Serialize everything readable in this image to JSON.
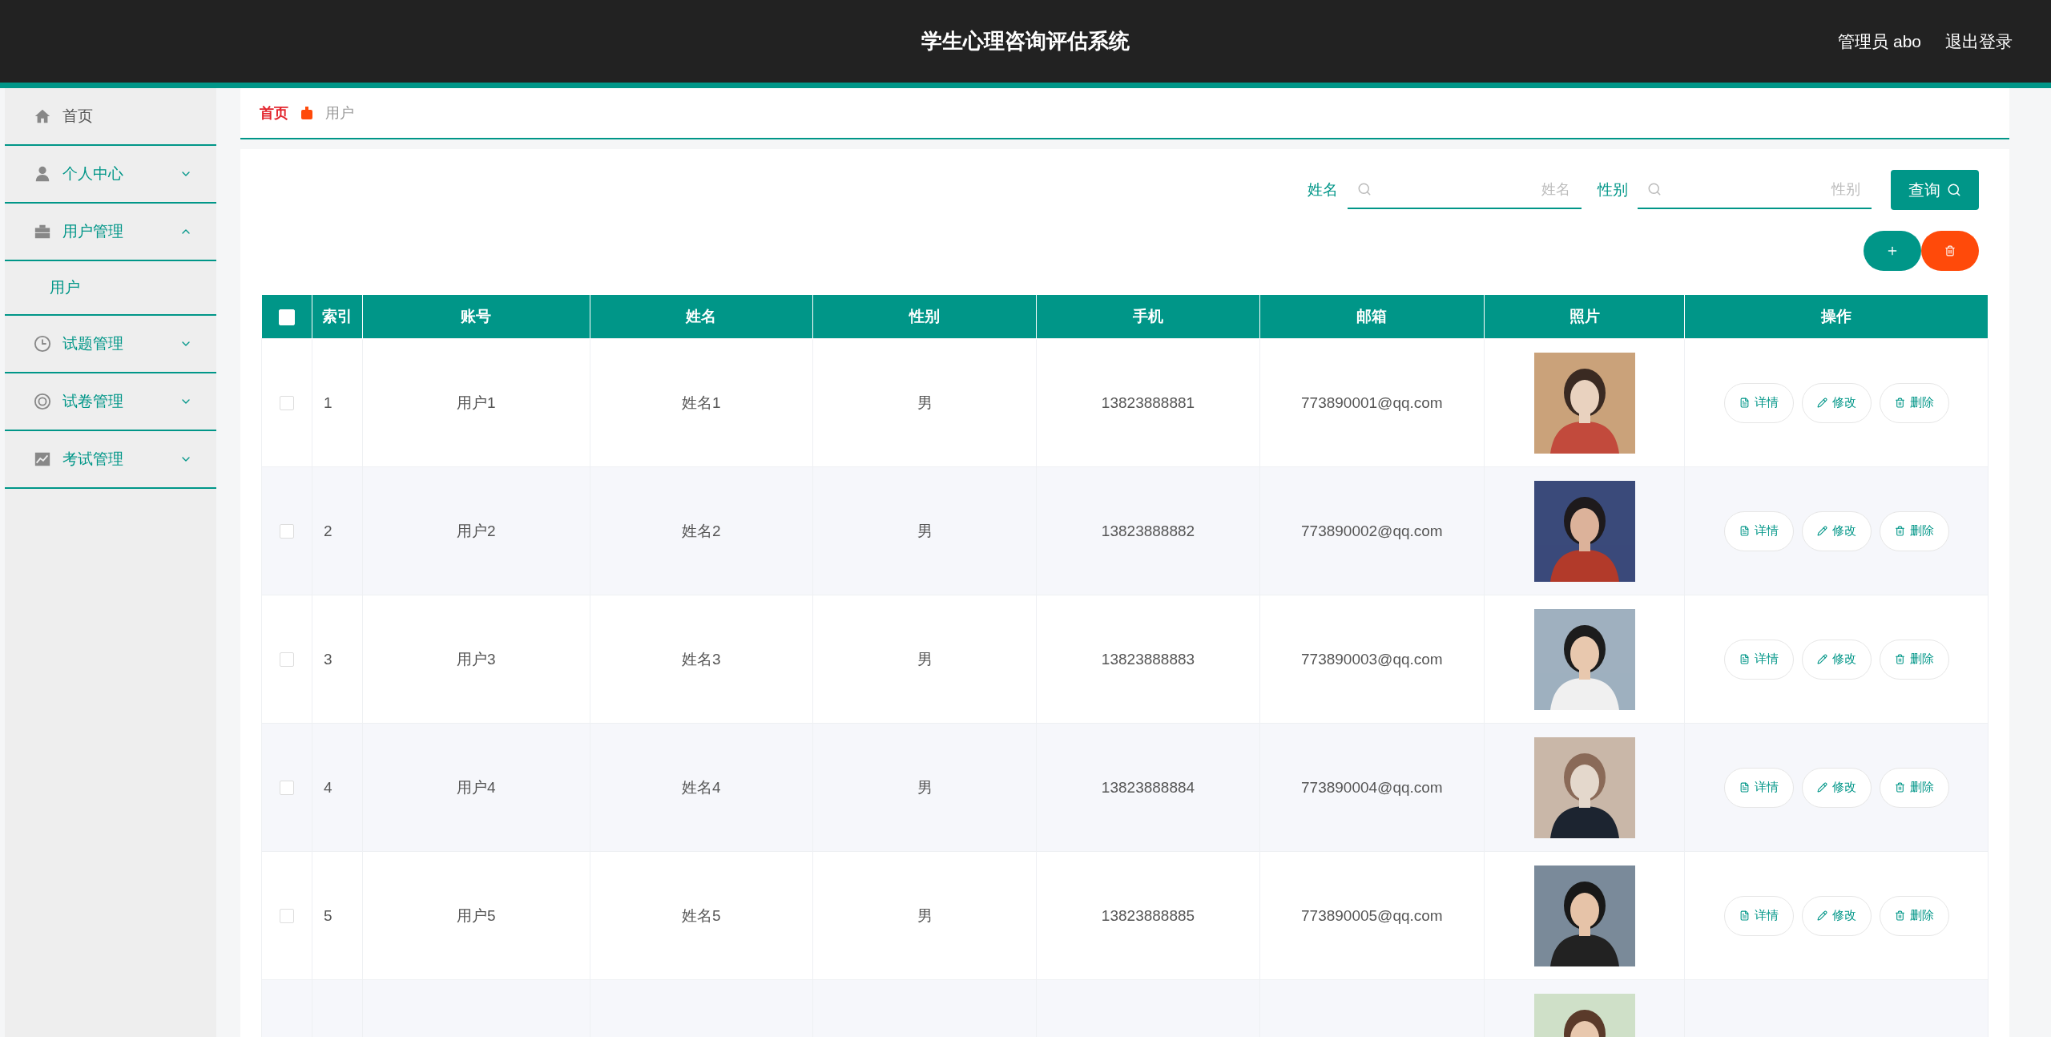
{
  "header": {
    "title": "学生心理咨询评估系统",
    "user": "管理员 abo",
    "logout": "退出登录"
  },
  "sidebar": {
    "items": [
      {
        "label": "首页",
        "kind": "link"
      },
      {
        "label": "个人中心",
        "kind": "menu",
        "expanded": false
      },
      {
        "label": "用户管理",
        "kind": "menu",
        "expanded": true,
        "children": [
          {
            "label": "用户",
            "selected": true
          }
        ]
      },
      {
        "label": "试题管理",
        "kind": "menu",
        "expanded": false
      },
      {
        "label": "试卷管理",
        "kind": "menu",
        "expanded": false
      },
      {
        "label": "考试管理",
        "kind": "menu",
        "expanded": false
      }
    ]
  },
  "breadcrumb": [
    "首页",
    "用户"
  ],
  "search": {
    "fields": [
      {
        "label": "姓名",
        "placeholder": "姓名"
      },
      {
        "label": "性别",
        "placeholder": "性别"
      }
    ],
    "button": "查询"
  },
  "table": {
    "all_checked": false,
    "columns": [
      "索引",
      "账号",
      "姓名",
      "性别",
      "手机",
      "邮箱",
      "照片",
      "操作"
    ],
    "rows": [
      {
        "checked": false,
        "index": "1",
        "account": "用户1",
        "name": "姓名1",
        "gender": "男",
        "phone": "13823888881",
        "email": "773890001@qq.com",
        "photo": {
          "kind": "picture"
        },
        "buttons": [
          "详情",
          "修改",
          "删除"
        ]
      },
      {
        "checked": false,
        "index": "2",
        "account": "用户2",
        "name": "姓名2",
        "gender": "男",
        "phone": "13823888882",
        "email": "773890002@qq.com",
        "photo": {
          "kind": "picture"
        },
        "buttons": [
          "详情",
          "修改",
          "删除"
        ]
      },
      {
        "checked": false,
        "index": "3",
        "account": "用户3",
        "name": "姓名3",
        "gender": "男",
        "phone": "13823888883",
        "email": "773890003@qq.com",
        "photo": {
          "kind": "picture"
        },
        "buttons": [
          "详情",
          "修改",
          "删除"
        ]
      },
      {
        "checked": false,
        "index": "4",
        "account": "用户4",
        "name": "姓名4",
        "gender": "男",
        "phone": "13823888884",
        "email": "773890004@qq.com",
        "photo": {
          "kind": "picture"
        },
        "buttons": [
          "详情",
          "修改",
          "删除"
        ]
      },
      {
        "checked": false,
        "index": "5",
        "account": "用户5",
        "name": "姓名5",
        "gender": "男",
        "phone": "13823888885",
        "email": "773890005@qq.com",
        "photo": {
          "kind": "picture"
        },
        "buttons": [
          "详情",
          "修改",
          "删除"
        ]
      },
      {
        "photo": {
          "kind": "picture"
        }
      }
    ]
  }
}
